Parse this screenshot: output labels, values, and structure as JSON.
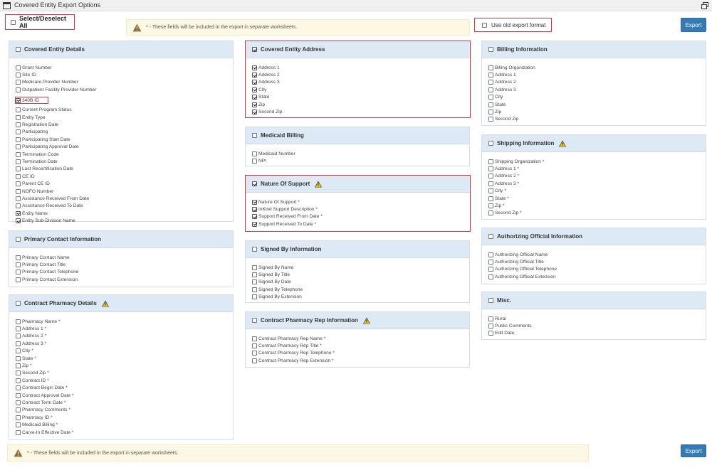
{
  "window": {
    "title": "Covered Entity Export Options"
  },
  "select_all": {
    "label": "Select/Deselect All",
    "checked": false
  },
  "notice": {
    "text": "* - These fields will be included in the export in separate worksheets."
  },
  "old_format": {
    "label": "Use old export format",
    "checked": false
  },
  "export_label": "Export",
  "panels": {
    "covered_entity_details": {
      "title": "Covered Entity Details",
      "checked": false,
      "warning": false,
      "items": [
        {
          "label": "Grant Number",
          "checked": false
        },
        {
          "label": "Site ID",
          "checked": false
        },
        {
          "label": "Medicare Provider Number",
          "checked": false
        },
        {
          "label": "Outpatient Facility Provider Number",
          "checked": false
        },
        {
          "label": "340B ID",
          "checked": true,
          "highlight": true
        },
        {
          "label": "Current Program Status",
          "checked": false
        },
        {
          "label": "Entity Type",
          "checked": false
        },
        {
          "label": "Registration Date",
          "checked": false
        },
        {
          "label": "Participating",
          "checked": false
        },
        {
          "label": "Participating Start Date",
          "checked": false
        },
        {
          "label": "Participating Approval Date",
          "checked": false
        },
        {
          "label": "Termination Code",
          "checked": false
        },
        {
          "label": "Termination Date",
          "checked": false
        },
        {
          "label": "Last Recertification Date",
          "checked": false
        },
        {
          "label": "CE ID",
          "checked": false
        },
        {
          "label": "Parent CE ID",
          "checked": false
        },
        {
          "label": "NOFO Number",
          "checked": false
        },
        {
          "label": "Assistance Received From Date",
          "checked": false
        },
        {
          "label": "Assistance Received To Date",
          "checked": false
        },
        {
          "label": "Entity Name",
          "checked": true
        },
        {
          "label": "Entity Sub-Division Name",
          "checked": true
        }
      ]
    },
    "primary_contact": {
      "title": "Primary Contact Information",
      "checked": false,
      "warning": false,
      "items": [
        {
          "label": "Primary Contact Name",
          "checked": false
        },
        {
          "label": "Primary Contact Title",
          "checked": false
        },
        {
          "label": "Primary Contact Telephone",
          "checked": false
        },
        {
          "label": "Primary Contact Extension",
          "checked": false
        }
      ]
    },
    "contract_pharmacy": {
      "title": "Contract Pharmacy Details",
      "checked": false,
      "warning": true,
      "items": [
        {
          "label": "Pharmacy Name *",
          "checked": false
        },
        {
          "label": "Address 1 *",
          "checked": false
        },
        {
          "label": "Address 2 *",
          "checked": false
        },
        {
          "label": "Address 3 *",
          "checked": false
        },
        {
          "label": "City *",
          "checked": false
        },
        {
          "label": "State *",
          "checked": false
        },
        {
          "label": "Zip *",
          "checked": false
        },
        {
          "label": "Second Zip *",
          "checked": false
        },
        {
          "label": "Contract ID *",
          "checked": false
        },
        {
          "label": "Contract Begin Date *",
          "checked": false
        },
        {
          "label": "Contract Approval Date *",
          "checked": false
        },
        {
          "label": "Contract Term Date *",
          "checked": false
        },
        {
          "label": "Pharmacy Comments *",
          "checked": false
        },
        {
          "label": "Pharmacy ID *",
          "checked": false
        },
        {
          "label": "Medicaid Billing *",
          "checked": false
        },
        {
          "label": "Carve-In Effective Date *",
          "checked": false
        }
      ]
    },
    "covered_entity_address": {
      "title": "Covered Entity Address",
      "checked": true,
      "warning": false,
      "items": [
        {
          "label": "Address 1",
          "checked": true
        },
        {
          "label": "Address 2",
          "checked": true
        },
        {
          "label": "Address 3",
          "checked": true
        },
        {
          "label": "City",
          "checked": true
        },
        {
          "label": "State",
          "checked": true
        },
        {
          "label": "Zip",
          "checked": true
        },
        {
          "label": "Second Zip",
          "checked": true
        }
      ]
    },
    "medicaid_billing": {
      "title": "Medicaid Billing",
      "checked": false,
      "warning": false,
      "items": [
        {
          "label": "Medicaid Number",
          "checked": false
        },
        {
          "label": "NPI",
          "checked": false
        }
      ]
    },
    "nature_of_support": {
      "title": "Nature Of Support",
      "checked": true,
      "warning": true,
      "items": [
        {
          "label": "Nature Of Support *",
          "checked": true
        },
        {
          "label": "InKind Support Description *",
          "checked": true
        },
        {
          "label": "Support Received From Date *",
          "checked": true
        },
        {
          "label": "Support Received To Date *",
          "checked": true
        }
      ]
    },
    "signed_by": {
      "title": "Signed By Information",
      "checked": false,
      "warning": false,
      "items": [
        {
          "label": "Signed By Name",
          "checked": false
        },
        {
          "label": "Signed By Title",
          "checked": false
        },
        {
          "label": "Signed By Date",
          "checked": false
        },
        {
          "label": "Signed By Telephone",
          "checked": false
        },
        {
          "label": "Signed By Extension",
          "checked": false
        }
      ]
    },
    "contract_pharmacy_rep": {
      "title": "Contract Pharmacy Rep Information",
      "checked": false,
      "warning": true,
      "items": [
        {
          "label": "Contract Pharmacy Rep Name *",
          "checked": false
        },
        {
          "label": "Contract Pharmacy Rep Title *",
          "checked": false
        },
        {
          "label": "Contract Pharmacy Rep Telephone *",
          "checked": false
        },
        {
          "label": "Contract Pharmacy Rep Extension *",
          "checked": false
        }
      ]
    },
    "billing_information": {
      "title": "Billing Information",
      "checked": false,
      "warning": false,
      "items": [
        {
          "label": "Billing Organization",
          "checked": false
        },
        {
          "label": "Address 1",
          "checked": false
        },
        {
          "label": "Address 2",
          "checked": false
        },
        {
          "label": "Address 3",
          "checked": false
        },
        {
          "label": "City",
          "checked": false
        },
        {
          "label": "State",
          "checked": false
        },
        {
          "label": "Zip",
          "checked": false
        },
        {
          "label": "Second Zip",
          "checked": false
        }
      ]
    },
    "shipping_information": {
      "title": "Shipping Information",
      "checked": false,
      "warning": true,
      "items": [
        {
          "label": "Shipping Organization *",
          "checked": false
        },
        {
          "label": "Address 1 *",
          "checked": false
        },
        {
          "label": "Address 2 *",
          "checked": false
        },
        {
          "label": "Address 3 *",
          "checked": false
        },
        {
          "label": "City *",
          "checked": false
        },
        {
          "label": "State *",
          "checked": false
        },
        {
          "label": "Zip *",
          "checked": false
        },
        {
          "label": "Second Zip *",
          "checked": false
        }
      ]
    },
    "authorizing_official": {
      "title": "Authorizing Official Information",
      "checked": false,
      "warning": false,
      "items": [
        {
          "label": "Authorizing Official Name",
          "checked": false
        },
        {
          "label": "Authorizing Official Title",
          "checked": false
        },
        {
          "label": "Authorizing Official Telephone",
          "checked": false
        },
        {
          "label": "Authorizing Official Extension",
          "checked": false
        }
      ]
    },
    "misc": {
      "title": "Misc.",
      "checked": false,
      "warning": false,
      "items": [
        {
          "label": "Rural",
          "checked": false
        },
        {
          "label": "Public Comments",
          "checked": false
        },
        {
          "label": "Edit Date",
          "checked": false
        }
      ]
    }
  }
}
